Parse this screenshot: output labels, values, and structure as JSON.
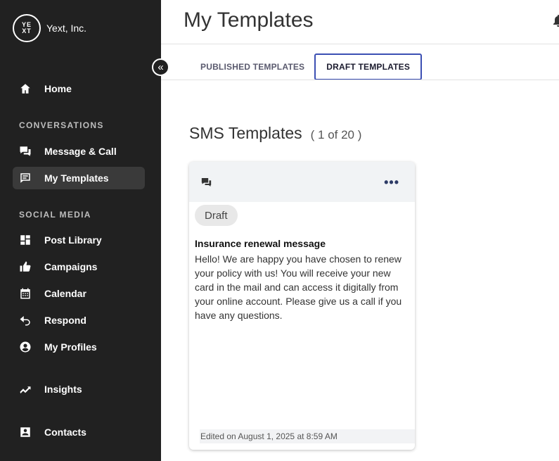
{
  "org": {
    "logo_text_top": "YE",
    "logo_text_bottom": "XT",
    "name": "Yext, Inc."
  },
  "sidebar": {
    "collapse_icon": "double-chevron-left-icon",
    "items": [
      {
        "label": "Home",
        "icon": "home-icon"
      },
      {
        "label": "Message & Call",
        "icon": "chat-bubbles-icon"
      },
      {
        "label": "My Templates",
        "icon": "template-icon",
        "active": true
      },
      {
        "label": "Post Library",
        "icon": "dashboard-icon"
      },
      {
        "label": "Campaigns",
        "icon": "thumbs-up-icon"
      },
      {
        "label": "Calendar",
        "icon": "calendar-icon"
      },
      {
        "label": "Respond",
        "icon": "reply-icon"
      },
      {
        "label": "My Profiles",
        "icon": "profile-icon"
      },
      {
        "label": "Insights",
        "icon": "trending-up-icon"
      },
      {
        "label": "Contacts",
        "icon": "contact-card-icon"
      }
    ],
    "sections": {
      "conversations": "CONVERSATIONS",
      "social_media": "SOCIAL MEDIA"
    }
  },
  "header": {
    "title": "My Templates"
  },
  "tabs": [
    {
      "label": "PUBLISHED TEMPLATES"
    },
    {
      "label": "DRAFT TEMPLATES",
      "active": true
    }
  ],
  "section": {
    "title": "SMS Templates",
    "count": "( 1 of 20 )"
  },
  "card": {
    "menu": "•••",
    "badge": "Draft",
    "title": "Insurance renewal message",
    "body": "Hello! We are happy you have chosen to renew your policy with us! You will receive your new card in the mail and can access it digitally from your online account. Please give us a call if you have any questions.",
    "footer": "Edited on August 1, 2025 at 8:59 AM"
  },
  "colors": {
    "sidebar_bg": "#212121",
    "active_tab_border": "#3b4fb3",
    "card_header_bg": "#f1f3f5"
  }
}
